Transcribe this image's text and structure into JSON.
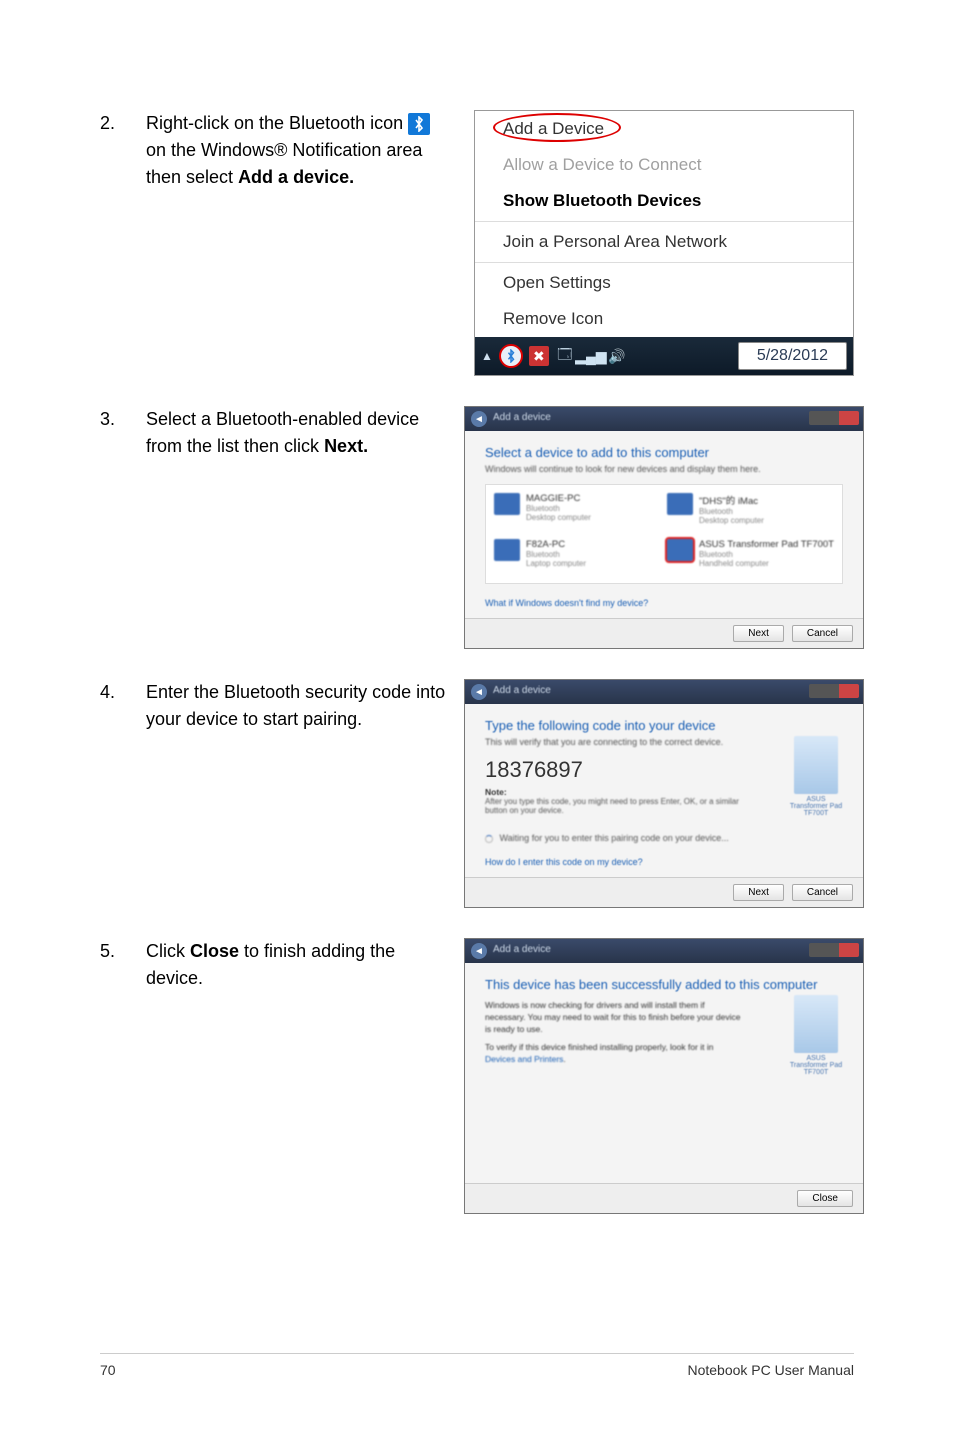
{
  "steps": [
    {
      "num": "2.",
      "text_before": "Right-click on the Bluetooth icon ",
      "text_after": " on the Windows® Notification area then select ",
      "bold": "Add a device."
    },
    {
      "num": "3.",
      "text": "  Select a Bluetooth-enabled device from the list then click ",
      "bold": "Next."
    },
    {
      "num": "4.",
      "text": "Enter the Bluetooth security code into your device to start pairing."
    },
    {
      "num": "5.",
      "text_before": "Click ",
      "bold": "Close",
      "text_after": " to finish adding the device."
    }
  ],
  "context_menu": {
    "items": [
      "Add a Device",
      "Allow a Device to Connect",
      "Show Bluetooth Devices",
      "Join a Personal Area Network",
      "Open Settings",
      "Remove Icon"
    ],
    "date": "5/28/2012"
  },
  "dialog_add": {
    "breadcrumb_hint": "Add a device",
    "heading": "Select a device to add to this computer",
    "sub": "Windows will continue to look for new devices and display them here.",
    "devices": [
      {
        "name": "MAGGIE-PC",
        "type": "Bluetooth",
        "kind": "Desktop computer"
      },
      {
        "name": "\"DHS\"的 iMac",
        "type": "Bluetooth",
        "kind": "Desktop computer"
      },
      {
        "name": "F82A-PC",
        "type": "Bluetooth",
        "kind": "Laptop computer"
      },
      {
        "name": "ASUS Transformer Pad TF700T",
        "type": "Bluetooth",
        "kind": "Handheld computer"
      }
    ],
    "link": "What if Windows doesn't find my device?",
    "buttons": [
      "Next",
      "Cancel"
    ]
  },
  "dialog_pair": {
    "breadcrumb_hint": "Add a device",
    "heading": "Type the following code into your device",
    "sub": "This will verify that you are connecting to the correct device.",
    "code": "18376897",
    "note_label": "Note:",
    "note": "After you type this code, you might need to press Enter, OK, or a similar button on your device.",
    "waiting": "Waiting for you to enter this pairing code on your device...",
    "link": "How do I enter this code on my device?",
    "device_caption": "ASUS Transformer Pad TF700T",
    "buttons": [
      "Next",
      "Cancel"
    ]
  },
  "dialog_done": {
    "breadcrumb_hint": "Add a device",
    "heading": "This device has been successfully added to this computer",
    "line1": "Windows is now checking for drivers and will install them if necessary. You may need to wait for this to finish before your device is ready to use.",
    "line2_a": "To verify if this device finished installing properly, look for it in ",
    "line2_b": "Devices and Printers",
    "device_caption": "ASUS Transformer Pad TF700T",
    "buttons": [
      "Close"
    ]
  },
  "footer": {
    "page": "70",
    "title": "Notebook PC User Manual"
  }
}
